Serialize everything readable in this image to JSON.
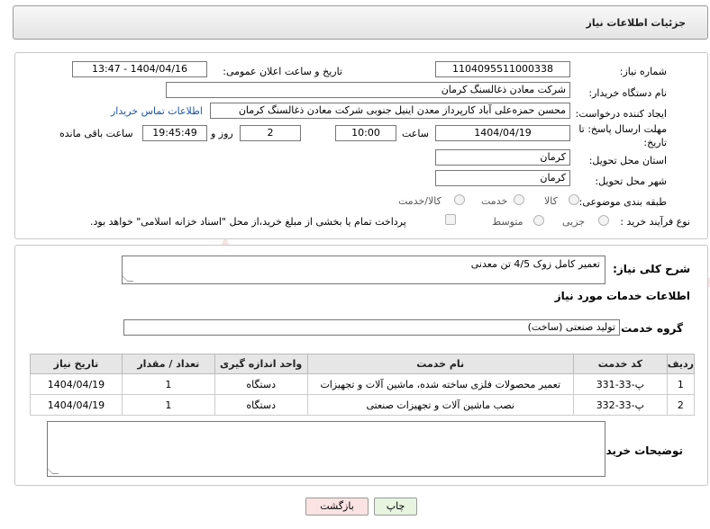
{
  "header": {
    "title": "جزئیات اطلاعات نیاز"
  },
  "info": {
    "need_number_label": "شماره نیاز:",
    "need_number": "1104095511000338",
    "announce_label": "تاریخ و ساعت اعلان عمومی:",
    "announce_value": "1404/04/16 - 13:47",
    "buyer_org_label": "نام دستگاه خریدار:",
    "buyer_org": "شرکت معادن ذغالسنگ کرمان",
    "creator_label": "ایجاد کننده درخواست:",
    "creator": "محسن حمزه‌علی آباد کارپرداز معدن اینیل جنوبی شرکت معادن ذغالسنگ کرمان",
    "contact_link": "اطلاعات تماس خریدار",
    "deadline_label_1": "مهلت ارسال پاسخ: تا",
    "deadline_label_2": "تاریخ:",
    "deadline_date": "1404/04/19",
    "time_label": "ساعت",
    "deadline_time": "10:00",
    "days_value": "2",
    "days_label": "روز و",
    "remaining_time": "19:45:49",
    "remaining_label": "ساعت باقی مانده",
    "province_label": "استان محل تحویل:",
    "province": "کرمان",
    "city_label": "شهر محل تحویل:",
    "city": "کرمان",
    "category_label": "طبقه بندی موضوعی:",
    "category_options": [
      "کالا",
      "خدمت",
      "کالا/خدمت"
    ],
    "process_label": "نوع فرآیند خرید :",
    "process_options": [
      "جزیی",
      "متوسط"
    ],
    "payment_note": "پرداخت تمام یا بخشی از مبلغ خرید،از محل \"اسناد خزانه اسلامی\" خواهد بود."
  },
  "details": {
    "summary_label": "شرح کلی نیاز:",
    "summary": "تعمیر کامل زوک 4/5 تن معدنی",
    "services_title": "اطلاعات خدمات مورد نیاز",
    "service_group_label": "گروه خدمت:",
    "service_group": "تولید صنعتی (ساخت)",
    "buyer_notes_label": "توضیحات خریدار:"
  },
  "table": {
    "headers": [
      "ردیف",
      "کد خدمت",
      "نام خدمت",
      "واحد اندازه گیری",
      "تعداد / مقدار",
      "تاریخ نیاز"
    ],
    "rows": [
      [
        "1",
        "پ-33-331",
        "تعمیر محصولات فلزی ساخته شده، ماشین آلات و تجهیزات",
        "دستگاه",
        "1",
        "1404/04/19"
      ],
      [
        "2",
        "پ-33-332",
        "نصب ماشین آلات و تجهیزات صنعتی",
        "دستگاه",
        "1",
        "1404/04/19"
      ]
    ]
  },
  "buttons": {
    "print": "چاپ",
    "back": "بازگشت"
  },
  "watermark": {
    "text": "AriaTender.neT"
  },
  "colors": {
    "link": "#1a55b0",
    "watermark": "#c0392b"
  }
}
